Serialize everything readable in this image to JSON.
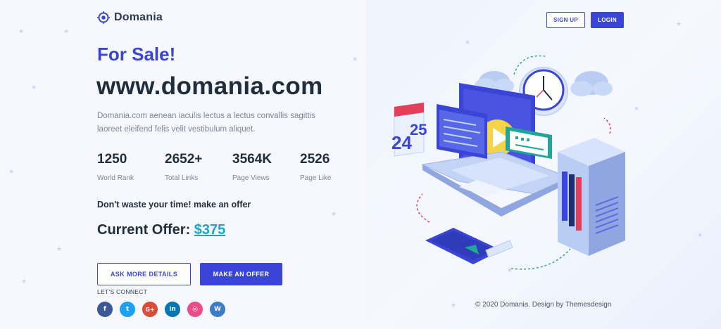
{
  "header": {
    "logo_text": "Domania",
    "signup_label": "SIGN UP",
    "login_label": "LOGIN"
  },
  "hero": {
    "for_sale": "For Sale!",
    "domain": "www.domania.com",
    "description": "Domania.com aenean iaculis lectus a lectus convallis sagittis laoreet eleifend felis velit vestibulum aliquet."
  },
  "stats": [
    {
      "value": "1250",
      "label": "World Rank"
    },
    {
      "value": "2652+",
      "label": "Total Links"
    },
    {
      "value": "3564K",
      "label": "Page Views"
    },
    {
      "value": "2526",
      "label": "Page Like"
    }
  ],
  "offer": {
    "tagline": "Don't waste your time! make an offer",
    "current_label": "Current Offer:",
    "price": "$375"
  },
  "actions": {
    "ask_label": "ASK MORE DETAILS",
    "offer_label": "MAKE AN OFFER"
  },
  "social": {
    "title": "LET'S CONNECT",
    "items": [
      {
        "icon": "facebook-icon",
        "glyph": "f",
        "color": "#3b5998"
      },
      {
        "icon": "twitter-icon",
        "glyph": "t",
        "color": "#1da1f2"
      },
      {
        "icon": "google-plus-icon",
        "glyph": "G+",
        "color": "#dd4b39"
      },
      {
        "icon": "linkedin-icon",
        "glyph": "in",
        "color": "#0077b5"
      },
      {
        "icon": "dribbble-icon",
        "glyph": "◎",
        "color": "#ea4c89"
      },
      {
        "icon": "wordpress-icon",
        "glyph": "W",
        "color": "#3d7cc9"
      }
    ]
  },
  "footer": {
    "copyright": "© 2020 Domania. Design by Themesdesign"
  },
  "illustration": {
    "calendar_top": "24",
    "calendar_bottom": "25"
  },
  "colors": {
    "accent": "#3a45d8",
    "link": "#1ca3d6",
    "heading": "#1f2d3d",
    "muted": "#7b8698"
  }
}
